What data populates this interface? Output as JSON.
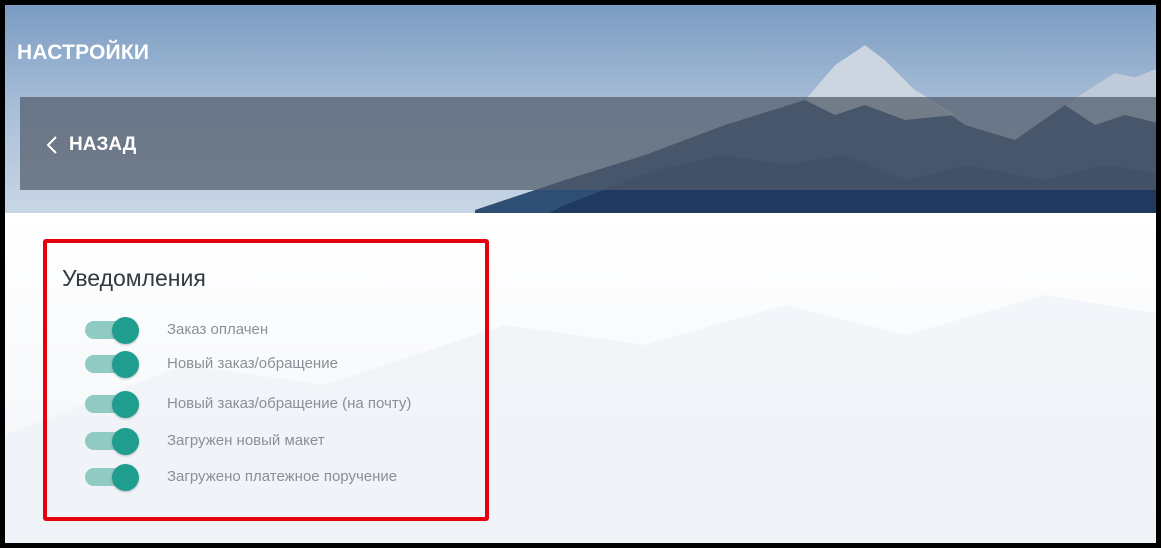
{
  "header": {
    "title": "НАСТРОЙКИ",
    "back_label": "НАЗАД"
  },
  "notifications": {
    "title": "Уведомления",
    "items": [
      {
        "label": "Заказ оплачен",
        "enabled": true
      },
      {
        "label": "Новый заказ/обращение",
        "enabled": true
      },
      {
        "label": "Новый заказ/обращение (на почту)",
        "enabled": true
      },
      {
        "label": "Загружен новый макет",
        "enabled": true
      },
      {
        "label": "Загружено платежное поручение",
        "enabled": true
      }
    ]
  },
  "colors": {
    "toggle_on_knob": "#1f9e8f",
    "toggle_on_track": "#8fcbc3",
    "highlight_border": "#e5000f"
  }
}
